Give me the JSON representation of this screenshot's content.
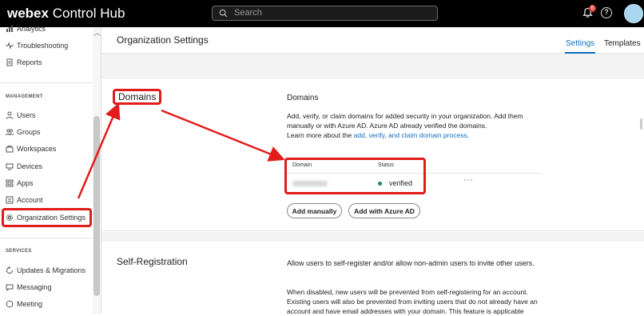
{
  "app": {
    "brand_bold": "webex",
    "brand_rest": " Control Hub"
  },
  "search": {
    "placeholder": "Search"
  },
  "notifications": {
    "count": "6"
  },
  "help": {
    "label": "?"
  },
  "sidebar": {
    "top_items": [
      {
        "label": "Analytics",
        "icon": "analytics-icon"
      },
      {
        "label": "Troubleshooting",
        "icon": "pulse-icon"
      },
      {
        "label": "Reports",
        "icon": "report-icon"
      }
    ],
    "management_label": "MANAGEMENT",
    "management_items": [
      {
        "label": "Users",
        "icon": "user-icon"
      },
      {
        "label": "Groups",
        "icon": "groups-icon"
      },
      {
        "label": "Workspaces",
        "icon": "workspace-icon"
      },
      {
        "label": "Devices",
        "icon": "devices-icon"
      },
      {
        "label": "Apps",
        "icon": "apps-icon"
      },
      {
        "label": "Account",
        "icon": "account-icon"
      },
      {
        "label": "Organization Settings",
        "icon": "gear-icon"
      }
    ],
    "services_label": "SERVICES",
    "services_items": [
      {
        "label": "Updates & Migrations",
        "icon": "updates-icon"
      },
      {
        "label": "Messaging",
        "icon": "message-icon"
      },
      {
        "label": "Meeting",
        "icon": "meeting-icon"
      }
    ]
  },
  "header": {
    "title": "Organization Settings",
    "tabs": [
      {
        "label": "Settings"
      },
      {
        "label": "Templates"
      }
    ]
  },
  "domains": {
    "section_label": "Domains",
    "heading": "Domains",
    "description": "Add, verify, or claim domains for added security in your organization. Add them manually or with Azure AD. Azure AD already verified the domains.",
    "learn_prefix": "Learn more about the ",
    "learn_link": "add, verify, and claim domain process",
    "learn_suffix": ".",
    "table_headers": {
      "domain": "Domain",
      "status": "Status"
    },
    "row": {
      "status": "verified",
      "more": "···"
    },
    "buttons": {
      "add_manually": "Add manually",
      "add_azure": "Add with Azure AD"
    }
  },
  "self_registration": {
    "heading": "Self-Registration",
    "p1": "Allow users to self-register and/or allow non-admin users to invite other users.",
    "p2": "When disabled, new users will be prevented from self-registering for an account. Existing users will also be prevented from inviting users that do not already have an account and have email addresses with your domain. This feature is applicable"
  },
  "colors": {
    "accent": "#0f6fbf",
    "annotation_red": "#e21b1b",
    "verified_green": "#1a8a5a"
  }
}
